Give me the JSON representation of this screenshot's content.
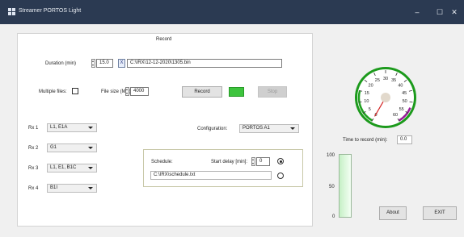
{
  "window": {
    "title": "Streamer PORTOS Light",
    "minimize": "–",
    "maximize": "☐",
    "close": "✕",
    "app_icon": "app-grid-icon"
  },
  "record": {
    "heading": "Record",
    "duration_label": "Duration (min)",
    "duration_value": "15.0",
    "x_button": "X",
    "file_path": "C:\\IRX\\12-12-2020\\1305.bin",
    "multiple_files_label": "Multiple files:",
    "file_size_label": "File size (MB):",
    "file_size_value": "4000",
    "record_button": "Record",
    "stop_button": "Stop",
    "configuration_label": "Configuration:",
    "configuration_value": "PORTOS A1"
  },
  "channels": [
    {
      "label": "Rx 1",
      "value": "L1, E1A"
    },
    {
      "label": "Rx 2",
      "value": "G1"
    },
    {
      "label": "Rx 3",
      "value": "L1, E1, B1C"
    },
    {
      "label": "Rx 4",
      "value": "B1I"
    }
  ],
  "schedule": {
    "label": "Schedule:",
    "start_delay_label": "Start delay [min]:",
    "start_delay_value": "0",
    "schedule_file": "C:\\IRX\\schedule.txt"
  },
  "status": {
    "time_to_record_label": "Time to record (min):",
    "time_to_record_value": "0.0",
    "about_button": "About",
    "exit_button": "EXIT"
  },
  "gauge": {
    "ticks": [
      "0",
      "5",
      "10",
      "15",
      "20",
      "25",
      "30",
      "35",
      "40",
      "45",
      "50",
      "55",
      "60"
    ],
    "value": 0
  },
  "level": {
    "ticks": [
      "100",
      "50",
      "0"
    ],
    "value": 0
  },
  "colors": {
    "titlebar": "#2b3a52",
    "gauge_green": "#20a020",
    "gauge_purple": "#9a1a9a",
    "led": "#3ec43e"
  }
}
